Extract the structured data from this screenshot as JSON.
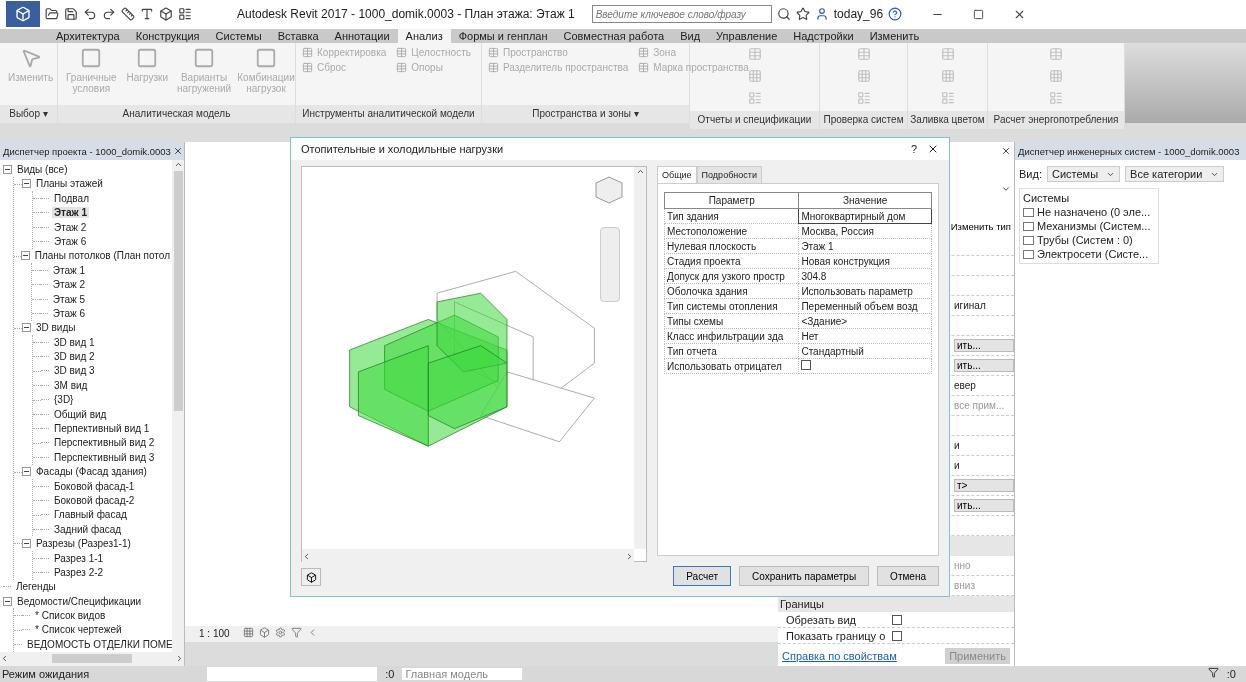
{
  "title_bar": {
    "title": "Autodesk Revit 2017 -   1000_domik.0003 - План этажа: Этаж 1",
    "search_placeholder": "Введите ключевое слово/фразу",
    "user": "today_96"
  },
  "ribbon_tabs": [
    {
      "label": "Архитектура",
      "selected": false
    },
    {
      "label": "Конструкция",
      "selected": false
    },
    {
      "label": "Системы",
      "selected": false
    },
    {
      "label": "Вставка",
      "selected": false
    },
    {
      "label": "Аннотации",
      "selected": false
    },
    {
      "label": "Анализ",
      "selected": true
    },
    {
      "label": "Формы и генплан",
      "selected": false
    },
    {
      "label": "Совместная работа",
      "selected": false
    },
    {
      "label": "Вид",
      "selected": false
    },
    {
      "label": "Управление",
      "selected": false
    },
    {
      "label": "Надстройки",
      "selected": false
    },
    {
      "label": "Изменить",
      "selected": false
    }
  ],
  "ribbon_panels": [
    {
      "label": "Выбор ▾",
      "kind": "big",
      "buttons": [
        "Изменить"
      ]
    },
    {
      "label": "Аналитическая модель",
      "kind": "big",
      "buttons": [
        "Граничные условия",
        "Нагрузки",
        "Варианты нагружений",
        "Комбинации нагрузок"
      ]
    },
    {
      "label": "Инструменты аналитической модели",
      "kind": "small",
      "buttons": [
        "Корректировка",
        "Целостность",
        "Сброс",
        "Опоры"
      ]
    },
    {
      "label": "Пространства и зоны ▾",
      "kind": "small",
      "buttons": [
        "Пространство",
        "Зона",
        "Разделитель пространства",
        "Марка пространства"
      ]
    },
    {
      "label": "Отчеты и спецификации",
      "kind": "icons"
    },
    {
      "label": "Проверка систем",
      "kind": "icons"
    },
    {
      "label": "Заливка цветом",
      "kind": "icons"
    },
    {
      "label": "Расчет энергопотребления",
      "kind": "icons"
    }
  ],
  "project_browser": {
    "title": "Диспетчер проекта - 1000_domik.0003",
    "tree": [
      {
        "label": "Виды (все)",
        "selected": false,
        "expanded": true,
        "children": [
          {
            "label": "Планы этажей",
            "selected": false,
            "expanded": true,
            "children": [
              {
                "label": "Подвал",
                "selected": false
              },
              {
                "label": "Этаж 1",
                "selected": true
              },
              {
                "label": "Этаж 2",
                "selected": false
              },
              {
                "label": "Этаж 6",
                "selected": false
              }
            ]
          },
          {
            "label": "Планы потолков (План потол",
            "selected": false,
            "expanded": true,
            "children": [
              {
                "label": "Этаж 1",
                "selected": false
              },
              {
                "label": "Этаж 2",
                "selected": false
              },
              {
                "label": "Этаж 5",
                "selected": false
              },
              {
                "label": "Этаж 6",
                "selected": false
              }
            ]
          },
          {
            "label": "3D виды",
            "selected": false,
            "expanded": true,
            "children": [
              {
                "label": "3D вид 1",
                "selected": false
              },
              {
                "label": "3D вид 2",
                "selected": false
              },
              {
                "label": "3D вид 3",
                "selected": false
              },
              {
                "label": "3M вид",
                "selected": false
              },
              {
                "label": "{3D}",
                "selected": false
              },
              {
                "label": "Общий вид",
                "selected": false
              },
              {
                "label": "Перпективный вид 1",
                "selected": false
              },
              {
                "label": "Перспективный вид 2",
                "selected": false
              },
              {
                "label": "Перспективный вид 3",
                "selected": false
              }
            ]
          },
          {
            "label": "Фасады (Фасад здания)",
            "selected": false,
            "expanded": true,
            "children": [
              {
                "label": "Боковой фасад-1",
                "selected": false
              },
              {
                "label": "Боковой фасад-2",
                "selected": false
              },
              {
                "label": "Главный фасад",
                "selected": false
              },
              {
                "label": "Задний фасад",
                "selected": false
              }
            ]
          },
          {
            "label": "Разрезы (Разрез1-1)",
            "selected": false,
            "expanded": true,
            "children": [
              {
                "label": "Разрез 1-1",
                "selected": false
              },
              {
                "label": "Разрез 2-2",
                "selected": false
              }
            ]
          }
        ]
      },
      {
        "label": "Легенды",
        "selected": false
      },
      {
        "label": "Ведомости/Спецификации",
        "selected": false,
        "expanded": true,
        "children": [
          {
            "label": "* Список видов",
            "selected": false
          },
          {
            "label": "* Список чертежей",
            "selected": false
          },
          {
            "label": "ВЕДОМОСТЬ ОТДЕЛКИ ПОМЕ",
            "selected": false
          }
        ]
      }
    ]
  },
  "view_bar": {
    "scale": "1 : 100"
  },
  "properties": {
    "edit_type": "Изменить тип",
    "rows": [
      {
        "kind": "blank"
      },
      {
        "kind": "blank"
      },
      {
        "kind": "blank"
      },
      {
        "kind": "text",
        "value": "игинал"
      },
      {
        "kind": "blank"
      },
      {
        "kind": "button",
        "value": "ить..."
      },
      {
        "kind": "button",
        "value": "ить..."
      },
      {
        "kind": "text",
        "value": "евер"
      },
      {
        "kind": "muted",
        "value": "все прим..."
      },
      {
        "kind": "blank"
      },
      {
        "kind": "text",
        "value": "и"
      },
      {
        "kind": "text",
        "value": "и"
      },
      {
        "kind": "button",
        "value": "т>"
      },
      {
        "kind": "button",
        "value": "ить..."
      },
      {
        "kind": "blank"
      },
      {
        "kind": "header"
      },
      {
        "kind": "muted",
        "value": "нно"
      },
      {
        "kind": "muted",
        "value": "вниз"
      }
    ],
    "section": "Границы",
    "checks": [
      {
        "label": "Обрезать вид",
        "checked": false
      },
      {
        "label": "Показать границу о",
        "checked": false
      }
    ],
    "help_link": "Справка по свойствам",
    "apply": "Применить"
  },
  "systems_browser": {
    "title": "Диспетчер инженерных систем - 1000_domik.0003",
    "view_label": "Вид:",
    "view_value": "Системы",
    "category_value": "Все категории",
    "root": "Системы",
    "items": [
      "Не назначено (0 эле...",
      "Механизмы (Систем...",
      "Трубы (Систем : 0)",
      "Электросети (Систе..."
    ]
  },
  "dialog": {
    "title": "Отопительные и холодильные нагрузки",
    "help": "?",
    "tabs": [
      {
        "label": "Общие",
        "selected": true
      },
      {
        "label": "Подробности",
        "selected": false
      }
    ],
    "columns": [
      "Параметр",
      "Значение"
    ],
    "rows": [
      {
        "param": "Тип здания",
        "value": "Многоквартирный дом",
        "kind": "text"
      },
      {
        "param": "Местоположение",
        "value": "Москва, Россия",
        "kind": "text"
      },
      {
        "param": "Нулевая плоскость",
        "value": "Этаж 1",
        "kind": "text"
      },
      {
        "param": "Стадия проекта",
        "value": "Новая конструкция",
        "kind": "text"
      },
      {
        "param": "Допуск для узкого простр",
        "value": "304.8",
        "kind": "text"
      },
      {
        "param": "Оболочка здания",
        "value": "Использовать параметр",
        "kind": "text"
      },
      {
        "param": "Тип системы отопления",
        "value": "Переменный объем возд",
        "kind": "text"
      },
      {
        "param": "Типы схемы",
        "value": "<Здание>",
        "kind": "text"
      },
      {
        "param": "Класс инфильтрации зда",
        "value": "Нет",
        "kind": "text"
      },
      {
        "param": "Тип отчета",
        "value": "Стандартный",
        "kind": "text"
      },
      {
        "param": "Использовать отрицател",
        "kind": "check",
        "checked": false
      }
    ],
    "buttons": [
      "Расчет",
      "Сохранить параметры",
      "Отмена"
    ]
  },
  "status_bar": {
    "text": "Режим ожидания",
    "count": ":0",
    "model": "Главная модель",
    "filter_count": ":0"
  }
}
